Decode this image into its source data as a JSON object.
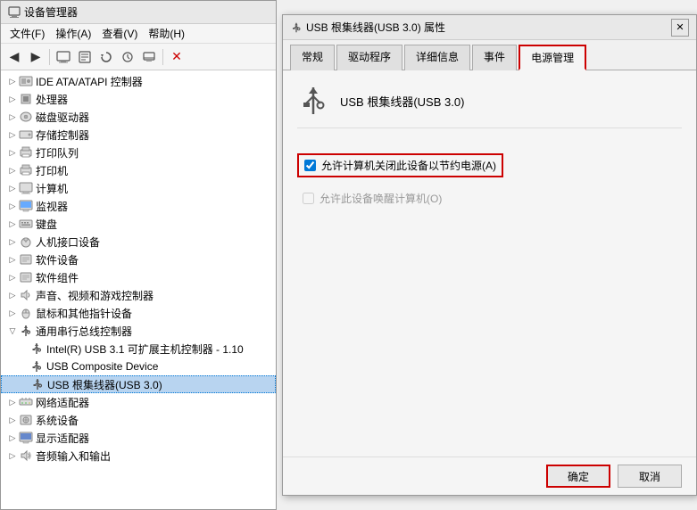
{
  "deviceManager": {
    "title": "设备管理器",
    "menuItems": [
      {
        "label": "文件(F)"
      },
      {
        "label": "操作(A)"
      },
      {
        "label": "查看(V)"
      },
      {
        "label": "帮助(H)"
      }
    ],
    "treeItems": [
      {
        "id": "ide",
        "indent": 0,
        "hasArrow": true,
        "collapsed": true,
        "icon": "💽",
        "label": "IDE ATA/ATAPI 控制器"
      },
      {
        "id": "cpu",
        "indent": 0,
        "hasArrow": true,
        "collapsed": true,
        "icon": "🔲",
        "label": "处理器"
      },
      {
        "id": "disk",
        "indent": 0,
        "hasArrow": true,
        "collapsed": true,
        "icon": "💾",
        "label": "磁盘驱动器"
      },
      {
        "id": "storage",
        "indent": 0,
        "hasArrow": true,
        "collapsed": true,
        "icon": "📦",
        "label": "存储控制器"
      },
      {
        "id": "printq",
        "indent": 0,
        "hasArrow": true,
        "collapsed": true,
        "icon": "🖨",
        "label": "打印队列"
      },
      {
        "id": "printer",
        "indent": 0,
        "hasArrow": true,
        "collapsed": true,
        "icon": "🖨",
        "label": "打印机"
      },
      {
        "id": "computer",
        "indent": 0,
        "hasArrow": true,
        "collapsed": true,
        "icon": "🖥",
        "label": "计算机"
      },
      {
        "id": "monitor",
        "indent": 0,
        "hasArrow": true,
        "collapsed": true,
        "icon": "🖥",
        "label": "监视器"
      },
      {
        "id": "keyboard",
        "indent": 0,
        "hasArrow": true,
        "collapsed": true,
        "icon": "⌨",
        "label": "键盘"
      },
      {
        "id": "hid",
        "indent": 0,
        "hasArrow": true,
        "collapsed": true,
        "icon": "🖱",
        "label": "人机接口设备"
      },
      {
        "id": "swdev",
        "indent": 0,
        "hasArrow": true,
        "collapsed": true,
        "icon": "📦",
        "label": "软件设备"
      },
      {
        "id": "swcomp",
        "indent": 0,
        "hasArrow": true,
        "collapsed": true,
        "icon": "📦",
        "label": "软件组件"
      },
      {
        "id": "sound",
        "indent": 0,
        "hasArrow": true,
        "collapsed": true,
        "icon": "🔊",
        "label": "声音、视频和游戏控制器"
      },
      {
        "id": "mouse",
        "indent": 0,
        "hasArrow": true,
        "collapsed": true,
        "icon": "🖱",
        "label": "鼠标和其他指针设备"
      },
      {
        "id": "usbctrl",
        "indent": 0,
        "hasArrow": true,
        "collapsed": false,
        "icon": "USB",
        "label": "通用串行总线控制器"
      },
      {
        "id": "intel-usb",
        "indent": 1,
        "hasArrow": false,
        "collapsed": false,
        "icon": "USB",
        "label": "Intel(R) USB 3.1 可扩展主机控制器 - 1.10"
      },
      {
        "id": "usb-comp",
        "indent": 1,
        "hasArrow": false,
        "collapsed": false,
        "icon": "USB",
        "label": "USB Composite Device"
      },
      {
        "id": "usb-hub",
        "indent": 1,
        "hasArrow": false,
        "collapsed": false,
        "icon": "USB",
        "label": "USB 根集线器(USB 3.0)",
        "selected": true,
        "highlighted": true
      },
      {
        "id": "netadapter",
        "indent": 0,
        "hasArrow": true,
        "collapsed": true,
        "icon": "🌐",
        "label": "网络适配器"
      },
      {
        "id": "sysdev",
        "indent": 0,
        "hasArrow": true,
        "collapsed": true,
        "icon": "⚙",
        "label": "系统设备"
      },
      {
        "id": "display",
        "indent": 0,
        "hasArrow": true,
        "collapsed": true,
        "icon": "🖥",
        "label": "显示适配器"
      },
      {
        "id": "audio",
        "indent": 0,
        "hasArrow": true,
        "collapsed": true,
        "icon": "🔊",
        "label": "音频输入和输出"
      }
    ]
  },
  "propsDialog": {
    "title": "USB 根集线器(USB 3.0) 属性",
    "tabs": [
      {
        "id": "general",
        "label": "常规"
      },
      {
        "id": "driver",
        "label": "驱动程序"
      },
      {
        "id": "details",
        "label": "详细信息"
      },
      {
        "id": "events",
        "label": "事件"
      },
      {
        "id": "power",
        "label": "电源管理",
        "active": true,
        "highlighted": true
      }
    ],
    "deviceName": "USB 根集线器(USB 3.0)",
    "checkboxes": [
      {
        "id": "allow-off",
        "label": "允许计算机关闭此设备以节约电源(A)",
        "checked": true,
        "highlighted": true
      },
      {
        "id": "allow-wake",
        "label": "允许此设备唤醒计算机(O)",
        "checked": false,
        "highlighted": false
      }
    ],
    "buttons": {
      "ok": "确定",
      "cancel": "取消"
    }
  }
}
